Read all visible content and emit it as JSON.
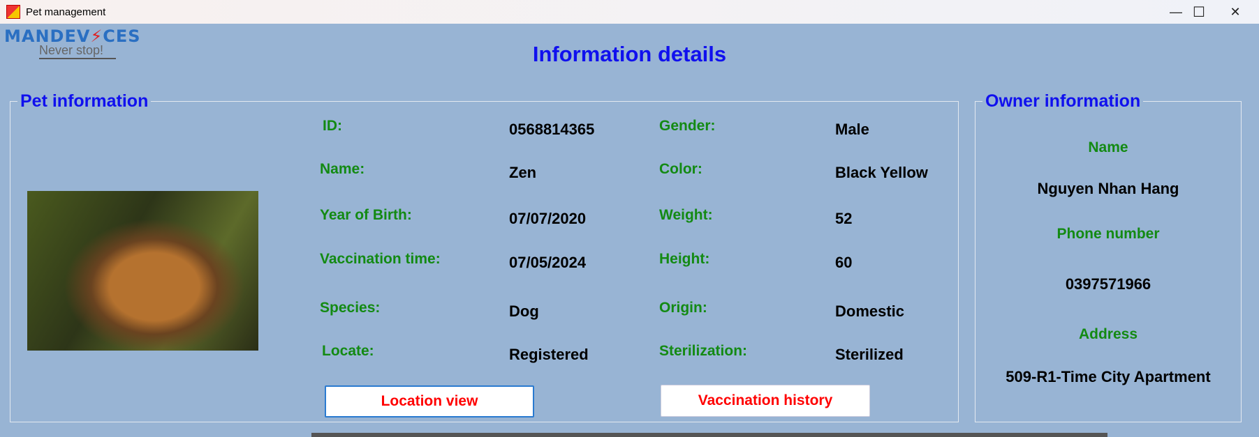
{
  "window": {
    "title": "Pet management",
    "minimize": "—",
    "maximize": "☐",
    "close": "✕"
  },
  "logo": {
    "brand_a": "MANDEV",
    "brand_bolt": "⚡",
    "brand_b": "CES",
    "tagline": "Never stop!"
  },
  "title": "Information details",
  "pet": {
    "legend": "Pet information",
    "fields": [
      {
        "label": "ID:",
        "value": "0568814365"
      },
      {
        "label": "Name:",
        "value": "Zen"
      },
      {
        "label": "Year of Birth:",
        "value": "07/07/2020"
      },
      {
        "label": "Vaccination time:",
        "value": "07/05/2024"
      },
      {
        "label": "Species:",
        "value": "Dog"
      },
      {
        "label": "Locate:",
        "value": "Registered"
      },
      {
        "label": "Gender:",
        "value": "Male"
      },
      {
        "label": "Color:",
        "value": "Black Yellow"
      },
      {
        "label": "Weight:",
        "value": "52"
      },
      {
        "label": "Height:",
        "value": "60"
      },
      {
        "label": "Origin:",
        "value": "Domestic"
      },
      {
        "label": "Sterilization:",
        "value": "Sterilized"
      }
    ],
    "location_button": "Location view",
    "vaccination_button": "Vaccination history"
  },
  "owner": {
    "legend": "Owner information",
    "name_label": "Name",
    "name": "Nguyen Nhan Hang",
    "phone_label": "Phone number",
    "phone": "0397571966",
    "address_label": "Address",
    "address": "509-R1-Time City Apartment"
  }
}
